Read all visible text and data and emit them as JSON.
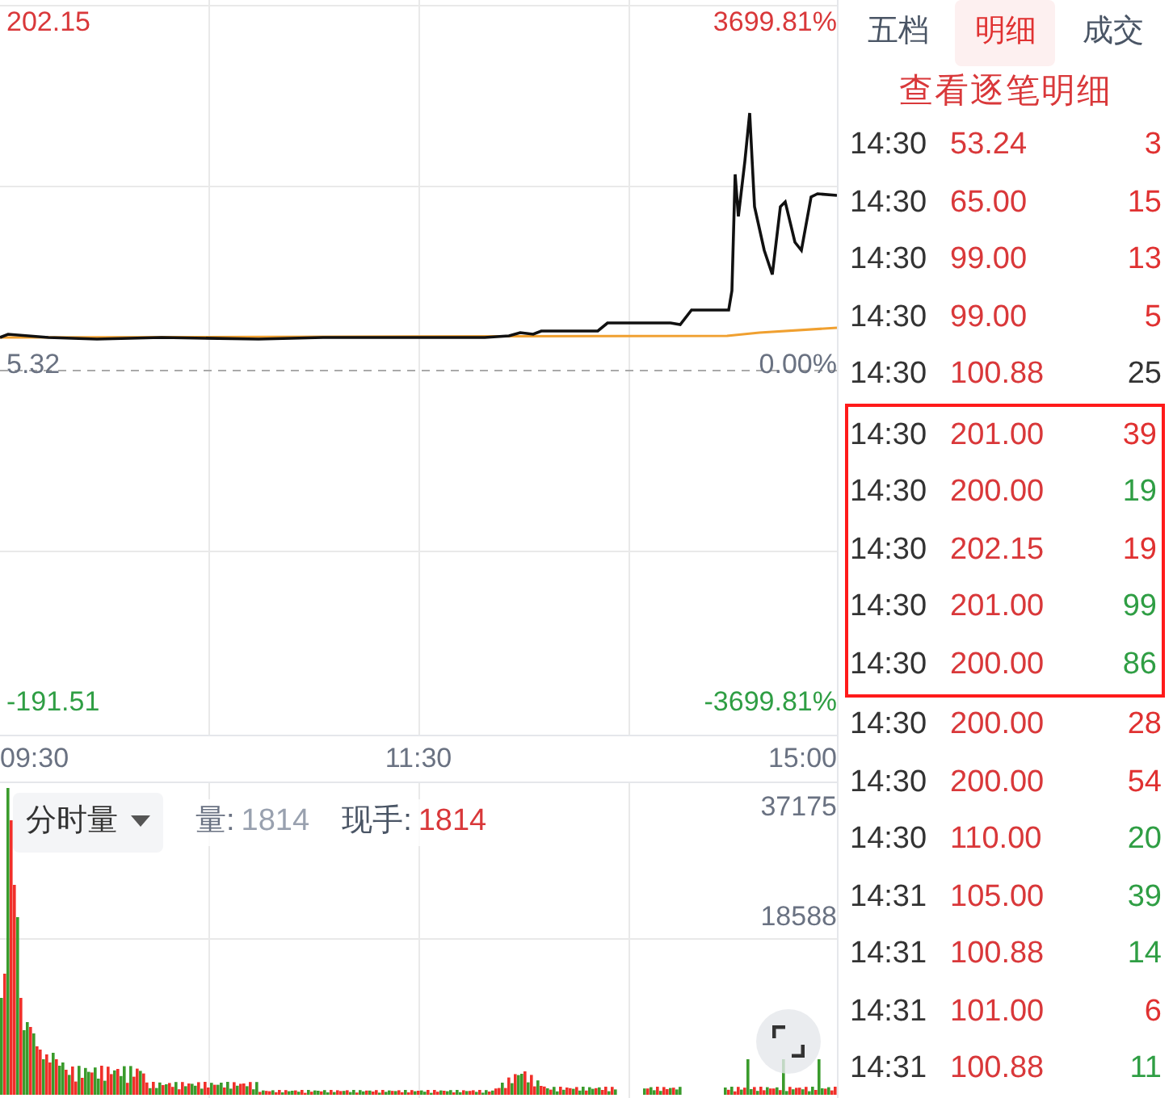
{
  "price_chart": {
    "kind": "picture",
    "top_price": "202.15",
    "top_percent": "3699.81%",
    "base_price": "5.32",
    "base_percent": "0.00%",
    "bottom_price": "-191.51",
    "bottom_percent": "-3699.81%"
  },
  "time_axis": [
    "09:30",
    "11:30",
    "15:00"
  ],
  "volume_chart": {
    "kind": "picture",
    "indicator": "分时量",
    "volume_label": "量:",
    "volume_value": "1814",
    "hand_label": "现手:",
    "hand_value": "1814",
    "top_scale": "37175",
    "mid_scale": "18588"
  },
  "tabs": [
    {
      "label": "五档",
      "selected": false
    },
    {
      "label": "明细",
      "selected": true
    },
    {
      "label": "成交",
      "selected": false
    }
  ],
  "detail_link": "查看逐笔明细",
  "trades": [
    {
      "time": "14:30",
      "price": "53.24",
      "volume": "3",
      "color": "#e03131",
      "highlighted": false
    },
    {
      "time": "14:30",
      "price": "65.00",
      "volume": "15",
      "color": "#e03131",
      "highlighted": false
    },
    {
      "time": "14:30",
      "price": "99.00",
      "volume": "13",
      "color": "#e03131",
      "highlighted": false
    },
    {
      "time": "14:30",
      "price": "99.00",
      "volume": "5",
      "color": "#e03131",
      "highlighted": false
    },
    {
      "time": "14:30",
      "price": "100.88",
      "volume": "25",
      "color": "#333333",
      "highlighted": false
    },
    {
      "time": "14:30",
      "price": "201.00",
      "volume": "39",
      "color": "#e03131",
      "highlighted": true
    },
    {
      "time": "14:30",
      "price": "200.00",
      "volume": "19",
      "color": "#2f9e44",
      "highlighted": true
    },
    {
      "time": "14:30",
      "price": "202.15",
      "volume": "19",
      "color": "#e03131",
      "highlighted": true
    },
    {
      "time": "14:30",
      "price": "201.00",
      "volume": "99",
      "color": "#2f9e44",
      "highlighted": true
    },
    {
      "time": "14:30",
      "price": "200.00",
      "volume": "86",
      "color": "#2f9e44",
      "highlighted": true
    },
    {
      "time": "14:30",
      "price": "200.00",
      "volume": "28",
      "color": "#e03131",
      "highlighted": false
    },
    {
      "time": "14:30",
      "price": "200.00",
      "volume": "54",
      "color": "#e03131",
      "highlighted": false
    },
    {
      "time": "14:30",
      "price": "110.00",
      "volume": "20",
      "color": "#2f9e44",
      "highlighted": false
    },
    {
      "time": "14:31",
      "price": "105.00",
      "volume": "39",
      "color": "#2f9e44",
      "highlighted": false
    },
    {
      "time": "14:31",
      "price": "100.88",
      "volume": "14",
      "color": "#2f9e44",
      "highlighted": false
    },
    {
      "time": "14:31",
      "price": "101.00",
      "volume": "6",
      "color": "#e03131",
      "highlighted": false
    },
    {
      "time": "14:31",
      "price": "100.88",
      "volume": "11",
      "color": "#2f9e44",
      "highlighted": false
    }
  ]
}
